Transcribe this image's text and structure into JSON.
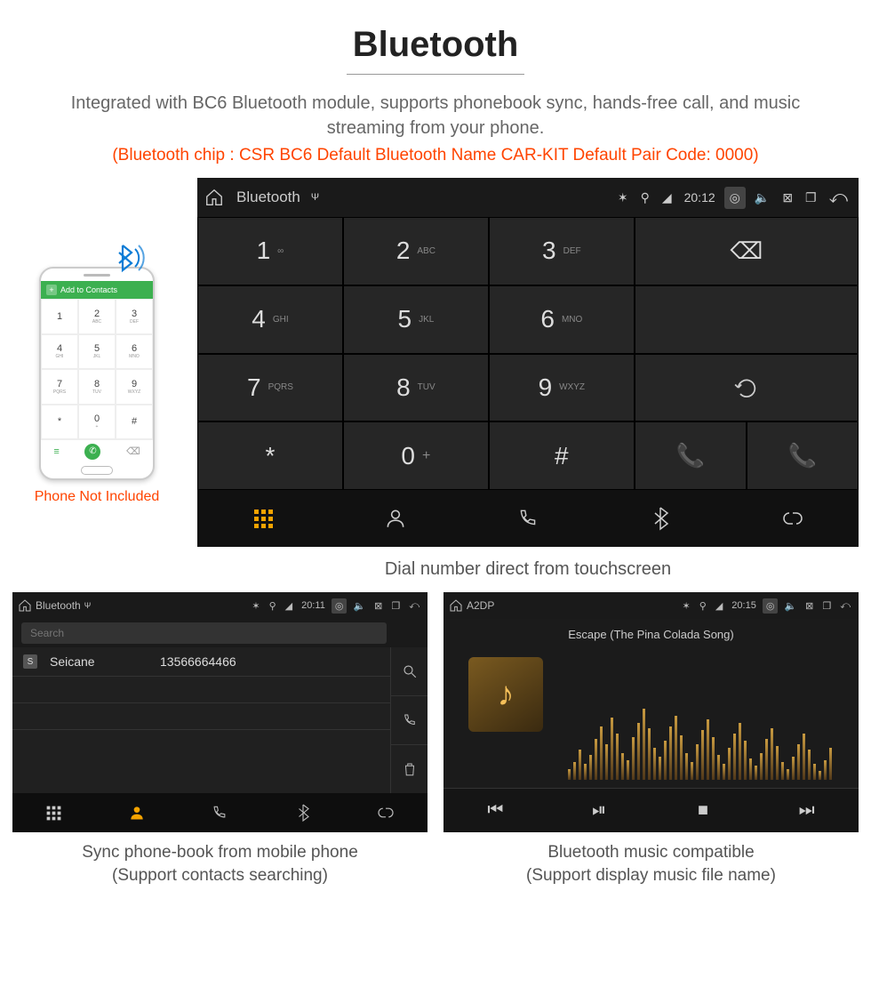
{
  "header": {
    "title": "Bluetooth",
    "description": "Integrated with BC6 Bluetooth module, supports phonebook sync, hands-free call, and music streaming from your phone.",
    "specs": "(Bluetooth chip : CSR BC6     Default Bluetooth Name CAR-KIT     Default Pair Code: 0000)"
  },
  "phone": {
    "header_label": "Add to Contacts",
    "note": "Phone Not Included",
    "keys": [
      {
        "n": "1",
        "s": ""
      },
      {
        "n": "2",
        "s": "ABC"
      },
      {
        "n": "3",
        "s": "DEF"
      },
      {
        "n": "4",
        "s": "GHI"
      },
      {
        "n": "5",
        "s": "JKL"
      },
      {
        "n": "6",
        "s": "MNO"
      },
      {
        "n": "7",
        "s": "PQRS"
      },
      {
        "n": "8",
        "s": "TUV"
      },
      {
        "n": "9",
        "s": "WXYZ"
      },
      {
        "n": "*",
        "s": ""
      },
      {
        "n": "0",
        "s": "+"
      },
      {
        "n": "#",
        "s": ""
      }
    ]
  },
  "dialer": {
    "status": {
      "title": "Bluetooth",
      "time": "20:12"
    },
    "keys": [
      {
        "n": "1",
        "s": "∞"
      },
      {
        "n": "2",
        "s": "ABC"
      },
      {
        "n": "3",
        "s": "DEF"
      },
      {
        "n": "4",
        "s": "GHI"
      },
      {
        "n": "5",
        "s": "JKL"
      },
      {
        "n": "6",
        "s": "MNO"
      },
      {
        "n": "7",
        "s": "PQRS"
      },
      {
        "n": "8",
        "s": "TUV"
      },
      {
        "n": "9",
        "s": "WXYZ"
      },
      {
        "n": "*",
        "s": ""
      },
      {
        "n": "0",
        "s": "+"
      },
      {
        "n": "#",
        "s": ""
      }
    ],
    "caption": "Dial number direct from touchscreen"
  },
  "contacts": {
    "status": {
      "title": "Bluetooth",
      "time": "20:11"
    },
    "search_placeholder": "Search",
    "row": {
      "badge": "S",
      "name": "Seicane",
      "number": "13566664466"
    },
    "caption_line1": "Sync phone-book from mobile phone",
    "caption_line2": "(Support contacts searching)"
  },
  "music": {
    "status": {
      "title": "A2DP",
      "time": "20:15"
    },
    "song": "Escape (The Pina Colada Song)",
    "caption_line1": "Bluetooth music compatible",
    "caption_line2": "(Support display music file name)"
  }
}
